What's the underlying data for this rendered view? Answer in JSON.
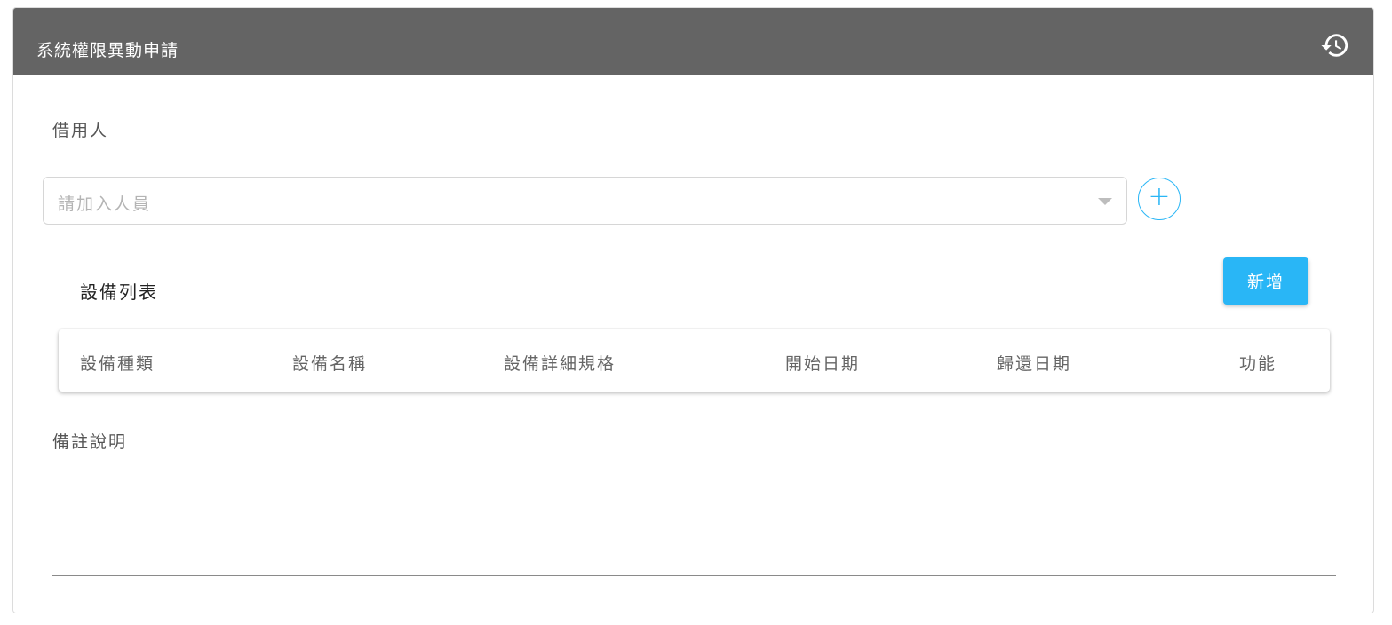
{
  "header": {
    "title": "系統權限異動申請",
    "history_icon": "history-icon"
  },
  "borrower": {
    "label": "借用人",
    "placeholder": "請加入人員",
    "add_icon": "+"
  },
  "equipment": {
    "title": "設備列表",
    "add_button": "新增",
    "columns": [
      "設備種類",
      "設備名稱",
      "設備詳細規格",
      "開始日期",
      "歸還日期",
      "功能"
    ]
  },
  "notes": {
    "label": "備註說明"
  },
  "colors": {
    "header_bg": "#646464",
    "accent": "#29b6f6"
  }
}
